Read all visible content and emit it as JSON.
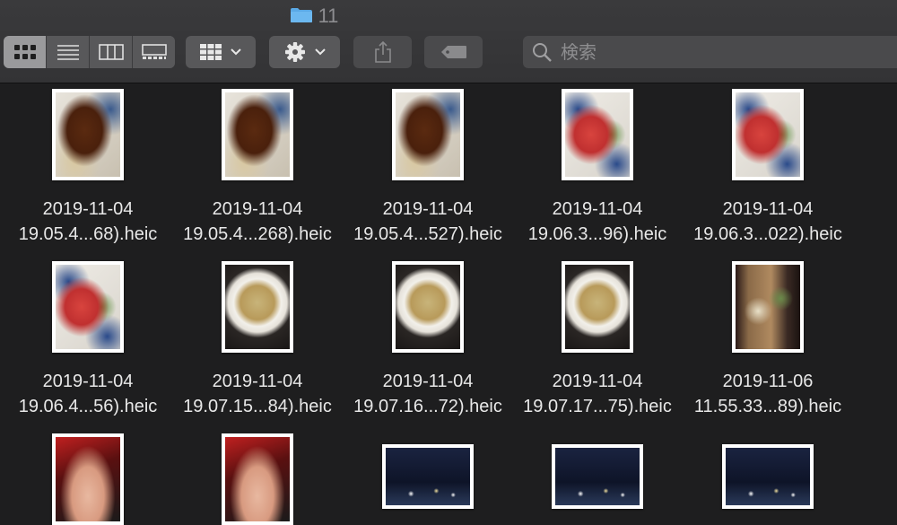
{
  "window": {
    "title": "11"
  },
  "toolbar": {
    "view_modes": [
      {
        "icon": "icon-view-grid-icon",
        "active": true
      },
      {
        "icon": "list-view-icon",
        "active": false
      },
      {
        "icon": "column-view-icon",
        "active": false
      },
      {
        "icon": "gallery-view-icon",
        "active": false
      }
    ],
    "group_icon": "group-grid-icon",
    "action_icon": "gear-icon",
    "share_icon": "share-icon",
    "tag_icon": "tag-icon",
    "search": {
      "placeholder": "検索",
      "icon": "search-icon"
    }
  },
  "files": [
    {
      "line1": "2019-11-04",
      "line2": "19.05.4...68).heic",
      "image": "eel",
      "orientation": "portrait"
    },
    {
      "line1": "2019-11-04",
      "line2": "19.05.4...268).heic",
      "image": "eel",
      "orientation": "portrait"
    },
    {
      "line1": "2019-11-04",
      "line2": "19.05.4...527).heic",
      "image": "eel",
      "orientation": "portrait"
    },
    {
      "line1": "2019-11-04",
      "line2": "19.06.3...96).heic",
      "image": "sashimi",
      "orientation": "portrait"
    },
    {
      "line1": "2019-11-04",
      "line2": "19.06.3...022).heic",
      "image": "sashimi",
      "orientation": "portrait"
    },
    {
      "line1": "2019-11-04",
      "line2": "19.06.4...56).heic",
      "image": "sashimi",
      "orientation": "portrait"
    },
    {
      "line1": "2019-11-04",
      "line2": "19.07.15...84).heic",
      "image": "soup",
      "orientation": "portrait"
    },
    {
      "line1": "2019-11-04",
      "line2": "19.07.16...72).heic",
      "image": "soup",
      "orientation": "portrait"
    },
    {
      "line1": "2019-11-04",
      "line2": "19.07.17...75).heic",
      "image": "soup",
      "orientation": "portrait"
    },
    {
      "line1": "2019-11-06",
      "line2": "11.55.33...89).heic",
      "image": "tray",
      "orientation": "portrait"
    },
    {
      "line1": "",
      "line2": "",
      "image": "hand",
      "orientation": "portrait"
    },
    {
      "line1": "",
      "line2": "",
      "image": "hand",
      "orientation": "portrait"
    },
    {
      "line1": "",
      "line2": "",
      "image": "night",
      "orientation": "landscape"
    },
    {
      "line1": "",
      "line2": "",
      "image": "night",
      "orientation": "landscape"
    },
    {
      "line1": "",
      "line2": "",
      "image": "night",
      "orientation": "landscape"
    }
  ]
}
